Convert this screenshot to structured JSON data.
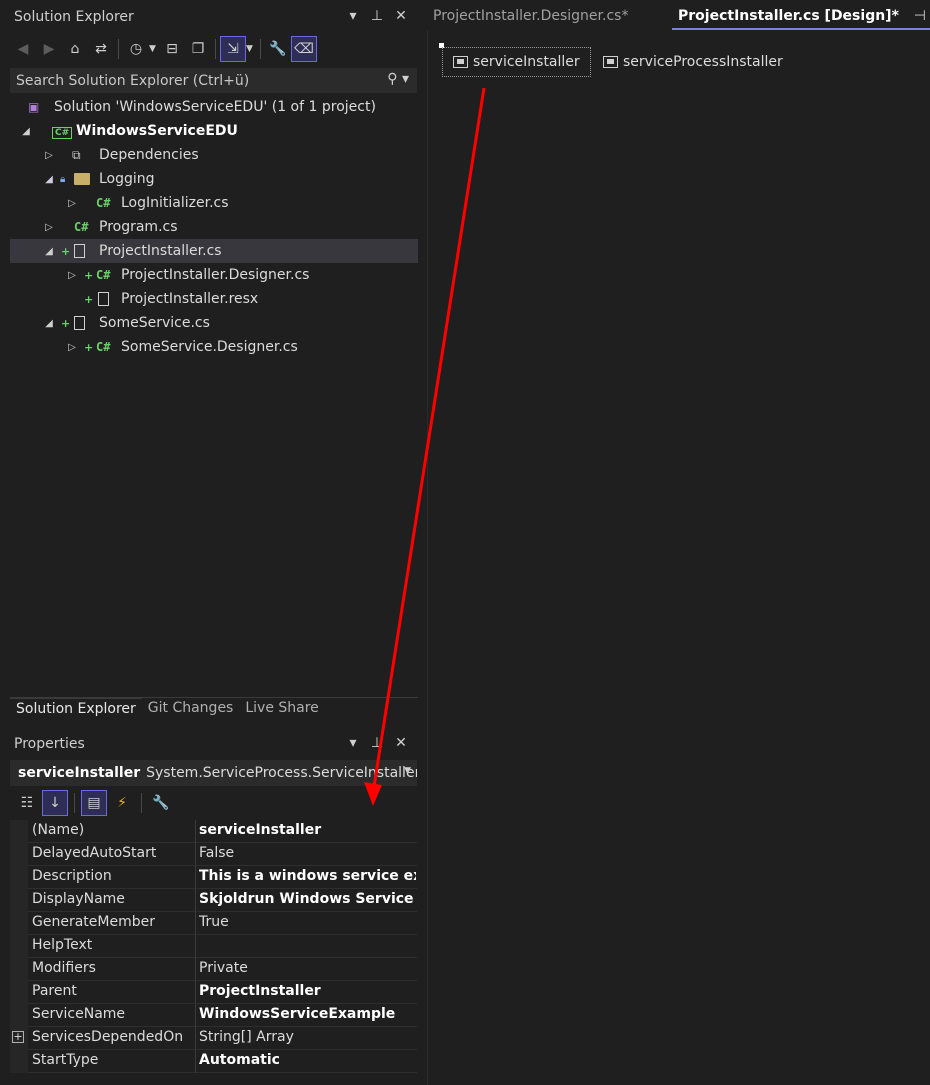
{
  "solution_explorer": {
    "title": "Solution Explorer",
    "title_buttons": [
      "▾",
      "📌",
      "✕"
    ],
    "search_placeholder": "Search Solution Explorer (Ctrl+ü)",
    "tree": [
      {
        "label": "Solution 'WindowsServiceEDU' (1 of 1 project)",
        "icon": "solution-icon",
        "bold": false
      },
      {
        "label": "WindowsServiceEDU",
        "icon": "csharp-project-icon",
        "bold": true
      },
      {
        "label": "Dependencies",
        "icon": "dependencies-icon"
      },
      {
        "label": "Logging",
        "icon": "folder-icon"
      },
      {
        "label": "LogInitializer.cs",
        "icon": "csharp-file-icon"
      },
      {
        "label": "Program.cs",
        "icon": "csharp-file-icon"
      },
      {
        "label": "ProjectInstaller.cs",
        "icon": "component-file-icon",
        "selected": true
      },
      {
        "label": "ProjectInstaller.Designer.cs",
        "icon": "csharp-file-icon"
      },
      {
        "label": "ProjectInstaller.resx",
        "icon": "resx-file-icon"
      },
      {
        "label": "SomeService.cs",
        "icon": "component-file-icon"
      },
      {
        "label": "SomeService.Designer.cs",
        "icon": "csharp-file-icon"
      }
    ],
    "bottom_tabs": [
      "Solution Explorer",
      "Git Changes",
      "Live Share"
    ],
    "active_bottom_tab": "Solution Explorer"
  },
  "properties": {
    "title": "Properties",
    "object_name": "serviceInstaller",
    "object_type": "System.ServiceProcess.ServiceInstaller",
    "rows": [
      {
        "name": "(Name)",
        "value": "serviceInstaller",
        "bold": true
      },
      {
        "name": "DelayedAutoStart",
        "value": "False",
        "bold": false
      },
      {
        "name": "Description",
        "value": "This is a windows service exam",
        "bold": true
      },
      {
        "name": "DisplayName",
        "value": "Skjoldrun Windows Service Exa",
        "bold": true
      },
      {
        "name": "GenerateMember",
        "value": "True",
        "bold": false
      },
      {
        "name": "HelpText",
        "value": "",
        "bold": false
      },
      {
        "name": "Modifiers",
        "value": "Private",
        "bold": false
      },
      {
        "name": "Parent",
        "value": "ProjectInstaller",
        "bold": true
      },
      {
        "name": "ServiceName",
        "value": "WindowsServiceExample",
        "bold": true
      },
      {
        "name": "ServicesDependedOn",
        "value": "String[] Array",
        "bold": false,
        "expandable": true
      },
      {
        "name": "StartType",
        "value": "Automatic",
        "bold": true
      }
    ]
  },
  "document": {
    "tabs": [
      {
        "label": "ProjectInstaller.Designer.cs*",
        "active": false
      },
      {
        "label": "ProjectInstaller.cs [Design]*",
        "active": true
      }
    ],
    "components": [
      {
        "label": "serviceInstaller",
        "selected": true
      },
      {
        "label": "serviceProcessInstaller",
        "selected": false
      }
    ]
  },
  "annotation": {
    "arrow_color": "#ff0000"
  },
  "colors": {
    "background": "#1f1f1f",
    "selection": "#37373d",
    "accent": "#8080e0",
    "csharp": "#6ccf6c"
  }
}
